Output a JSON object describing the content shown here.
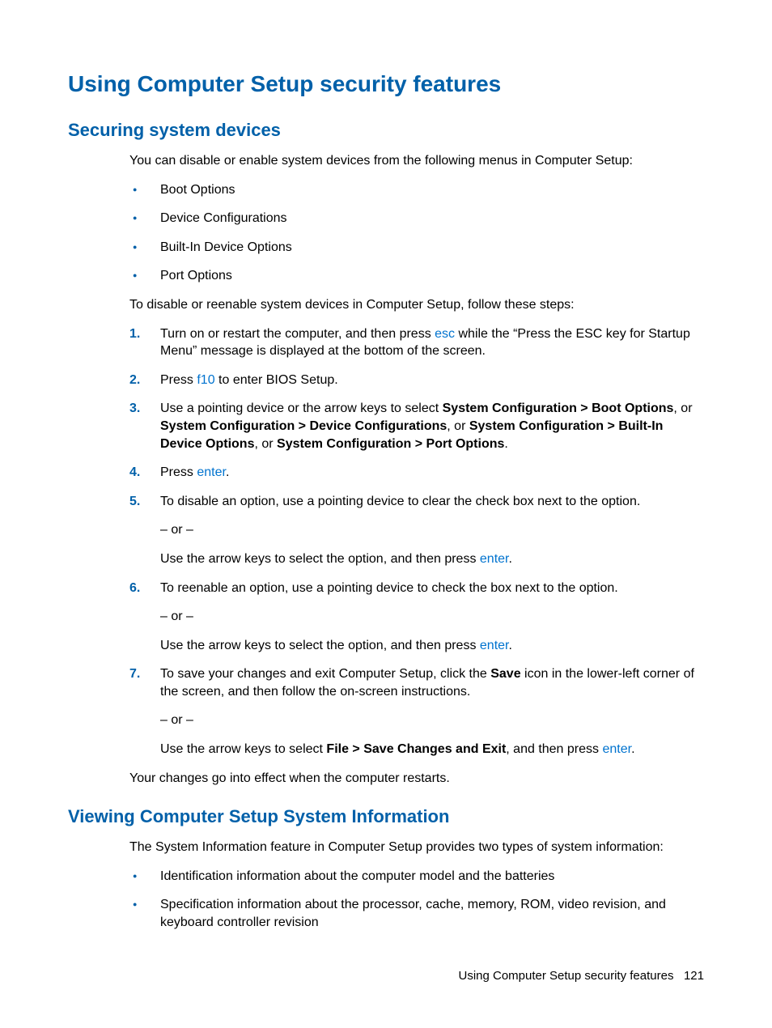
{
  "h1": "Using Computer Setup security features",
  "sec1": {
    "h2": "Securing system devices",
    "intro": "You can disable or enable system devices from the following menus in Computer Setup:",
    "bullets": [
      "Boot Options",
      "Device Configurations",
      "Built-In Device Options",
      "Port Options"
    ],
    "lead": "To disable or reenable system devices in Computer Setup, follow these steps:",
    "steps": {
      "s1a": "Turn on or restart the computer, and then press ",
      "s1key": "esc",
      "s1b": " while the “Press the ESC key for Startup Menu” message is displayed at the bottom of the screen.",
      "s2a": "Press ",
      "s2key": "f10",
      "s2b": " to enter BIOS Setup.",
      "s3a": "Use a pointing device or the arrow keys to select ",
      "s3b1": "System Configuration > Boot Options",
      "s3c1": ", or ",
      "s3b2": "System Configuration > Device Configurations",
      "s3c2": ", or ",
      "s3b3": "System Configuration > Built-In Device Options",
      "s3c3": ", or ",
      "s3b4": "System Configuration > Port Options",
      "s3end": ".",
      "s4a": "Press ",
      "s4key": "enter",
      "s4b": ".",
      "s5a": "To disable an option, use a pointing device to clear the check box next to the option.",
      "or": "– or –",
      "s5b_pre": "Use the arrow keys to select the option, and then press ",
      "s5b_key": "enter",
      "s5b_post": ".",
      "s6a": "To reenable an option, use a pointing device to check the box next to the option.",
      "s6b_pre": "Use the arrow keys to select the option, and then press ",
      "s6b_key": "enter",
      "s6b_post": ".",
      "s7a": "To save your changes and exit Computer Setup, click the ",
      "s7bold": "Save",
      "s7b": " icon in the lower-left corner of the screen, and then follow the on-screen instructions.",
      "s7c_pre": "Use the arrow keys to select ",
      "s7c_bold": "File > Save Changes and Exit",
      "s7c_mid": ", and then press ",
      "s7c_key": "enter",
      "s7c_post": "."
    },
    "outro": "Your changes go into effect when the computer restarts."
  },
  "sec2": {
    "h2": "Viewing Computer Setup System Information",
    "intro": "The System Information feature in Computer Setup provides two types of system information:",
    "bullets": [
      "Identification information about the computer model and the batteries",
      "Specification information about the processor, cache, memory, ROM, video revision, and keyboard controller revision"
    ]
  },
  "footer": {
    "text": "Using Computer Setup security features",
    "page": "121"
  }
}
